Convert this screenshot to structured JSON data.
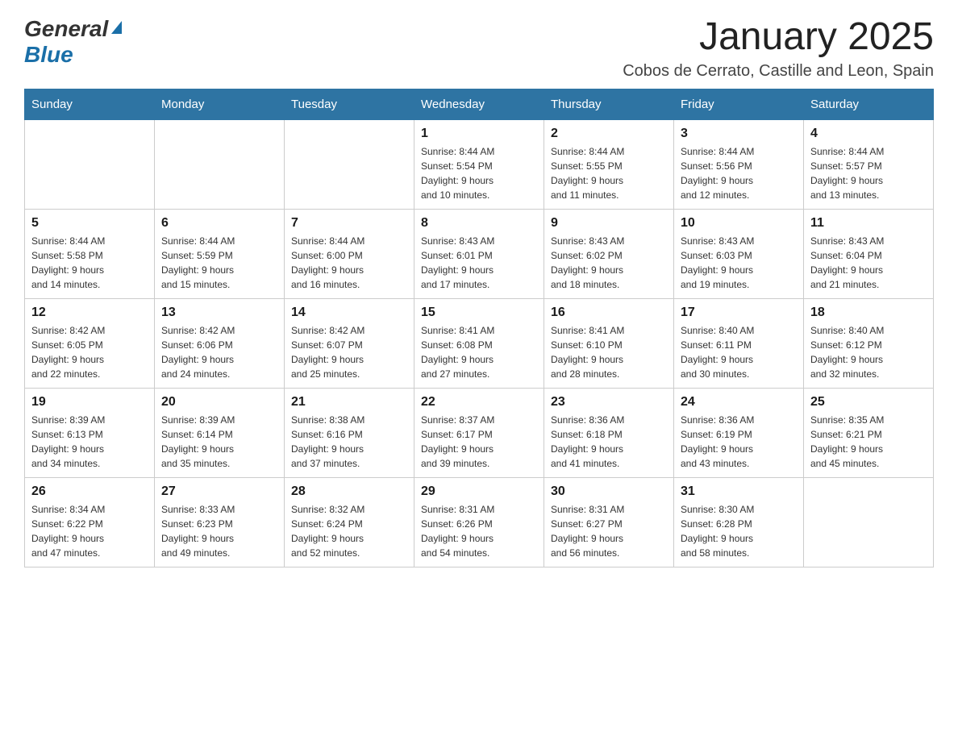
{
  "logo": {
    "general": "General",
    "blue": "Blue"
  },
  "header": {
    "title": "January 2025",
    "subtitle": "Cobos de Cerrato, Castille and Leon, Spain"
  },
  "weekdays": [
    "Sunday",
    "Monday",
    "Tuesday",
    "Wednesday",
    "Thursday",
    "Friday",
    "Saturday"
  ],
  "weeks": [
    [
      {
        "day": "",
        "info": ""
      },
      {
        "day": "",
        "info": ""
      },
      {
        "day": "",
        "info": ""
      },
      {
        "day": "1",
        "info": "Sunrise: 8:44 AM\nSunset: 5:54 PM\nDaylight: 9 hours\nand 10 minutes."
      },
      {
        "day": "2",
        "info": "Sunrise: 8:44 AM\nSunset: 5:55 PM\nDaylight: 9 hours\nand 11 minutes."
      },
      {
        "day": "3",
        "info": "Sunrise: 8:44 AM\nSunset: 5:56 PM\nDaylight: 9 hours\nand 12 minutes."
      },
      {
        "day": "4",
        "info": "Sunrise: 8:44 AM\nSunset: 5:57 PM\nDaylight: 9 hours\nand 13 minutes."
      }
    ],
    [
      {
        "day": "5",
        "info": "Sunrise: 8:44 AM\nSunset: 5:58 PM\nDaylight: 9 hours\nand 14 minutes."
      },
      {
        "day": "6",
        "info": "Sunrise: 8:44 AM\nSunset: 5:59 PM\nDaylight: 9 hours\nand 15 minutes."
      },
      {
        "day": "7",
        "info": "Sunrise: 8:44 AM\nSunset: 6:00 PM\nDaylight: 9 hours\nand 16 minutes."
      },
      {
        "day": "8",
        "info": "Sunrise: 8:43 AM\nSunset: 6:01 PM\nDaylight: 9 hours\nand 17 minutes."
      },
      {
        "day": "9",
        "info": "Sunrise: 8:43 AM\nSunset: 6:02 PM\nDaylight: 9 hours\nand 18 minutes."
      },
      {
        "day": "10",
        "info": "Sunrise: 8:43 AM\nSunset: 6:03 PM\nDaylight: 9 hours\nand 19 minutes."
      },
      {
        "day": "11",
        "info": "Sunrise: 8:43 AM\nSunset: 6:04 PM\nDaylight: 9 hours\nand 21 minutes."
      }
    ],
    [
      {
        "day": "12",
        "info": "Sunrise: 8:42 AM\nSunset: 6:05 PM\nDaylight: 9 hours\nand 22 minutes."
      },
      {
        "day": "13",
        "info": "Sunrise: 8:42 AM\nSunset: 6:06 PM\nDaylight: 9 hours\nand 24 minutes."
      },
      {
        "day": "14",
        "info": "Sunrise: 8:42 AM\nSunset: 6:07 PM\nDaylight: 9 hours\nand 25 minutes."
      },
      {
        "day": "15",
        "info": "Sunrise: 8:41 AM\nSunset: 6:08 PM\nDaylight: 9 hours\nand 27 minutes."
      },
      {
        "day": "16",
        "info": "Sunrise: 8:41 AM\nSunset: 6:10 PM\nDaylight: 9 hours\nand 28 minutes."
      },
      {
        "day": "17",
        "info": "Sunrise: 8:40 AM\nSunset: 6:11 PM\nDaylight: 9 hours\nand 30 minutes."
      },
      {
        "day": "18",
        "info": "Sunrise: 8:40 AM\nSunset: 6:12 PM\nDaylight: 9 hours\nand 32 minutes."
      }
    ],
    [
      {
        "day": "19",
        "info": "Sunrise: 8:39 AM\nSunset: 6:13 PM\nDaylight: 9 hours\nand 34 minutes."
      },
      {
        "day": "20",
        "info": "Sunrise: 8:39 AM\nSunset: 6:14 PM\nDaylight: 9 hours\nand 35 minutes."
      },
      {
        "day": "21",
        "info": "Sunrise: 8:38 AM\nSunset: 6:16 PM\nDaylight: 9 hours\nand 37 minutes."
      },
      {
        "day": "22",
        "info": "Sunrise: 8:37 AM\nSunset: 6:17 PM\nDaylight: 9 hours\nand 39 minutes."
      },
      {
        "day": "23",
        "info": "Sunrise: 8:36 AM\nSunset: 6:18 PM\nDaylight: 9 hours\nand 41 minutes."
      },
      {
        "day": "24",
        "info": "Sunrise: 8:36 AM\nSunset: 6:19 PM\nDaylight: 9 hours\nand 43 minutes."
      },
      {
        "day": "25",
        "info": "Sunrise: 8:35 AM\nSunset: 6:21 PM\nDaylight: 9 hours\nand 45 minutes."
      }
    ],
    [
      {
        "day": "26",
        "info": "Sunrise: 8:34 AM\nSunset: 6:22 PM\nDaylight: 9 hours\nand 47 minutes."
      },
      {
        "day": "27",
        "info": "Sunrise: 8:33 AM\nSunset: 6:23 PM\nDaylight: 9 hours\nand 49 minutes."
      },
      {
        "day": "28",
        "info": "Sunrise: 8:32 AM\nSunset: 6:24 PM\nDaylight: 9 hours\nand 52 minutes."
      },
      {
        "day": "29",
        "info": "Sunrise: 8:31 AM\nSunset: 6:26 PM\nDaylight: 9 hours\nand 54 minutes."
      },
      {
        "day": "30",
        "info": "Sunrise: 8:31 AM\nSunset: 6:27 PM\nDaylight: 9 hours\nand 56 minutes."
      },
      {
        "day": "31",
        "info": "Sunrise: 8:30 AM\nSunset: 6:28 PM\nDaylight: 9 hours\nand 58 minutes."
      },
      {
        "day": "",
        "info": ""
      }
    ]
  ]
}
